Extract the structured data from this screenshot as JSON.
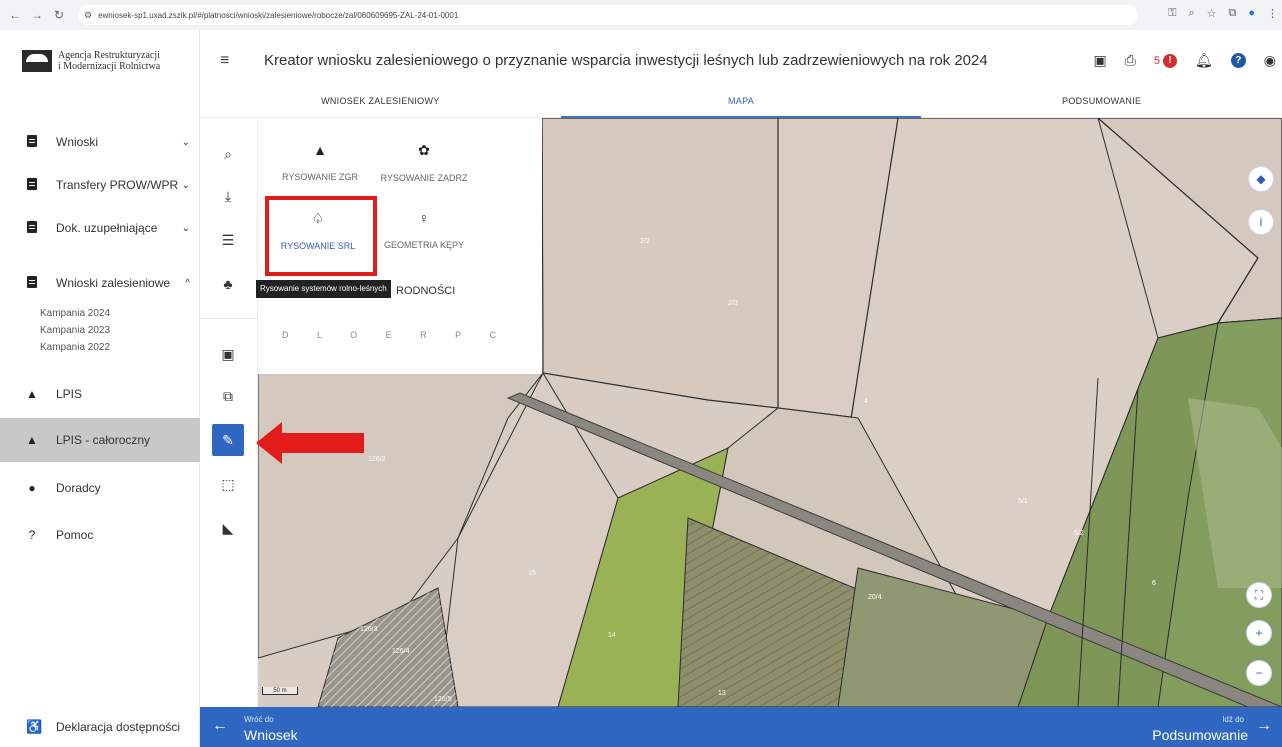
{
  "browser": {
    "url": "ewniosek-sp1.uxad.zszik.pl/#/platnosci/wnioski/zalesieniowe/robocze/zal/060609695-ZAL-24-01-0001"
  },
  "sidebar": {
    "logo": {
      "line1": "Agencja Restrukturyzacji",
      "line2": "i Modernizacji Rolnictwa"
    },
    "items": [
      {
        "label": "Wnioski",
        "icon": "clipboard-icon",
        "chevron": "⌄"
      },
      {
        "label": "Transfery PROW/WPR",
        "icon": "clipboard-icon",
        "chevron": "⌄"
      },
      {
        "label": "Dok. uzupełniające",
        "icon": "clipboard-icon",
        "chevron": "⌄"
      },
      {
        "label": "Wnioski zalesieniowe",
        "icon": "clipboard-icon",
        "chevron": "^"
      },
      {
        "label": "LPIS",
        "icon": "mountain-icon"
      },
      {
        "label": "LPIS - całoroczny",
        "icon": "mountain-icon"
      },
      {
        "label": "Doradcy",
        "icon": "person-icon"
      },
      {
        "label": "Pomoc",
        "icon": "help-icon"
      }
    ],
    "campaigns": [
      "Kampania 2024",
      "Kampania 2023",
      "Kampania 2022"
    ],
    "accessibility": "Deklaracja dostępności"
  },
  "header": {
    "title": "Kreator wniosku zalesieniowego o przyznanie wsparcia inwestycji leśnych lub zadrzewieniowych na rok 2024",
    "error_count": "5"
  },
  "tabs": [
    {
      "label": "WNIOSEK ZALESIENIOWY"
    },
    {
      "label": "MAPA"
    },
    {
      "label": "PODSUMOWANIE"
    }
  ],
  "draw_panel": {
    "options": [
      {
        "label": "RYSOWANIE ZGR",
        "icon": "tree-icon"
      },
      {
        "label": "RYSOWANIE ZADRZ",
        "icon": "sprout-icon"
      },
      {
        "label": "RYSOWANIE SRL",
        "icon": "deciduous-tree-icon"
      },
      {
        "label": "GEOMETRIA KĘPY",
        "icon": "location-tree-icon"
      }
    ],
    "tooltip": "Rysowanie systemów rolno-leśnych",
    "partial_label": "RODNOŚCI",
    "letters": "D L O E R P C"
  },
  "map": {
    "parcel_labels": [
      "2/2",
      "2/3",
      "4",
      "126/2",
      "5/1",
      "5/2",
      "6",
      "15",
      "20/4",
      "14",
      "126/3",
      "126/4",
      "126/5",
      "13"
    ],
    "scale": "50 m"
  },
  "footer": {
    "back_sub": "Wróć do",
    "back_main": "Wniosek",
    "next_sub": "Idź do",
    "next_main": "Podsumowanie"
  },
  "colors": {
    "primary": "#2f67c2",
    "highlight": "#e21b1b",
    "error": "#d32f2f"
  }
}
